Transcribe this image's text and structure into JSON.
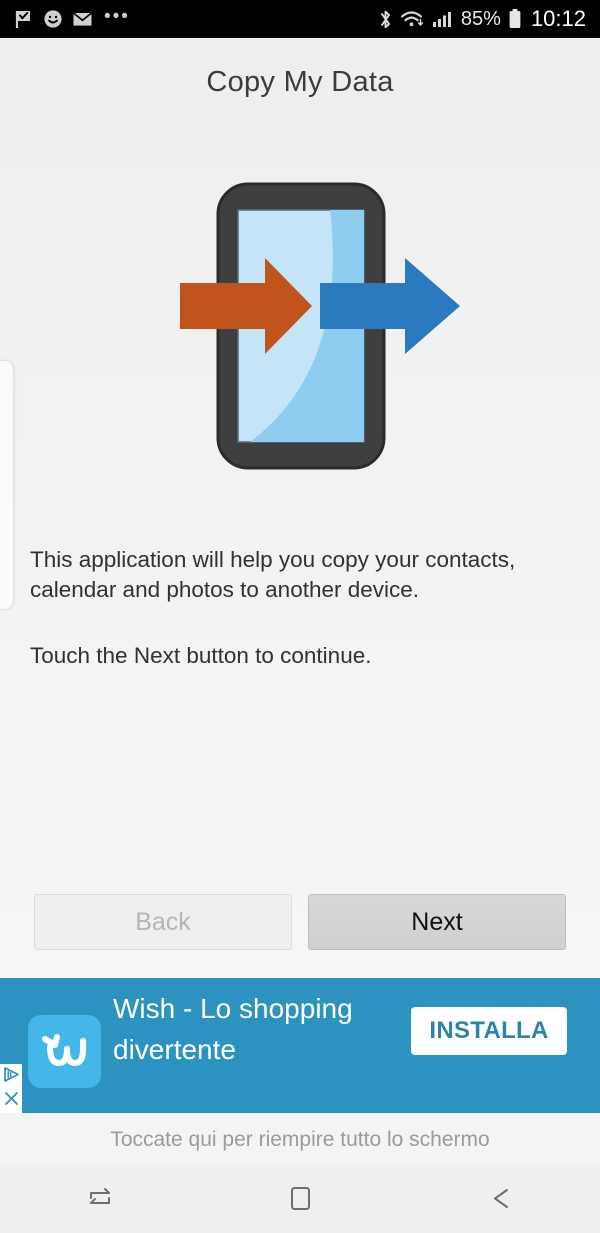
{
  "statusbar": {
    "left_icons": [
      "flag-check-icon",
      "smiley-icon",
      "envelope-icon"
    ],
    "overflow": "•••",
    "bluetooth": "bluetooth-icon",
    "wifi": "wifi-icon",
    "signal": "signal-bars-icon",
    "battery_percent": "85%",
    "battery": "battery-icon",
    "clock": "10:12"
  },
  "app": {
    "title": "Copy My Data",
    "illustration": {
      "name": "phone-transfer-illustration",
      "phone_body_color": "#3b3b3b",
      "screen_color": "#c5e4f7",
      "screen_highlight_color": "#7fc6ee",
      "arrow_in_color": "#bf551c",
      "arrow_out_color": "#2b79bf"
    },
    "body_line1": "This application will help you copy your contacts, calendar and photos to another device.",
    "body_line2": "Touch the Next button to continue.",
    "buttons": {
      "back": "Back",
      "next": "Next"
    }
  },
  "ad": {
    "background_color": "#2c92bf",
    "app_icon_letter": "w",
    "app_icon_color": "#45b6e8",
    "title": "Wish - Lo shopping divertente",
    "install_label": "INSTALLA",
    "install_text_color": "#2c84ad",
    "adchoices_icon": "adchoices-icon",
    "close_icon": "close-icon"
  },
  "hint": {
    "text": "Toccate qui per riempire tutto lo schermo"
  },
  "navbar": {
    "recents": "recents-icon",
    "home": "home-icon",
    "back": "back-icon"
  }
}
